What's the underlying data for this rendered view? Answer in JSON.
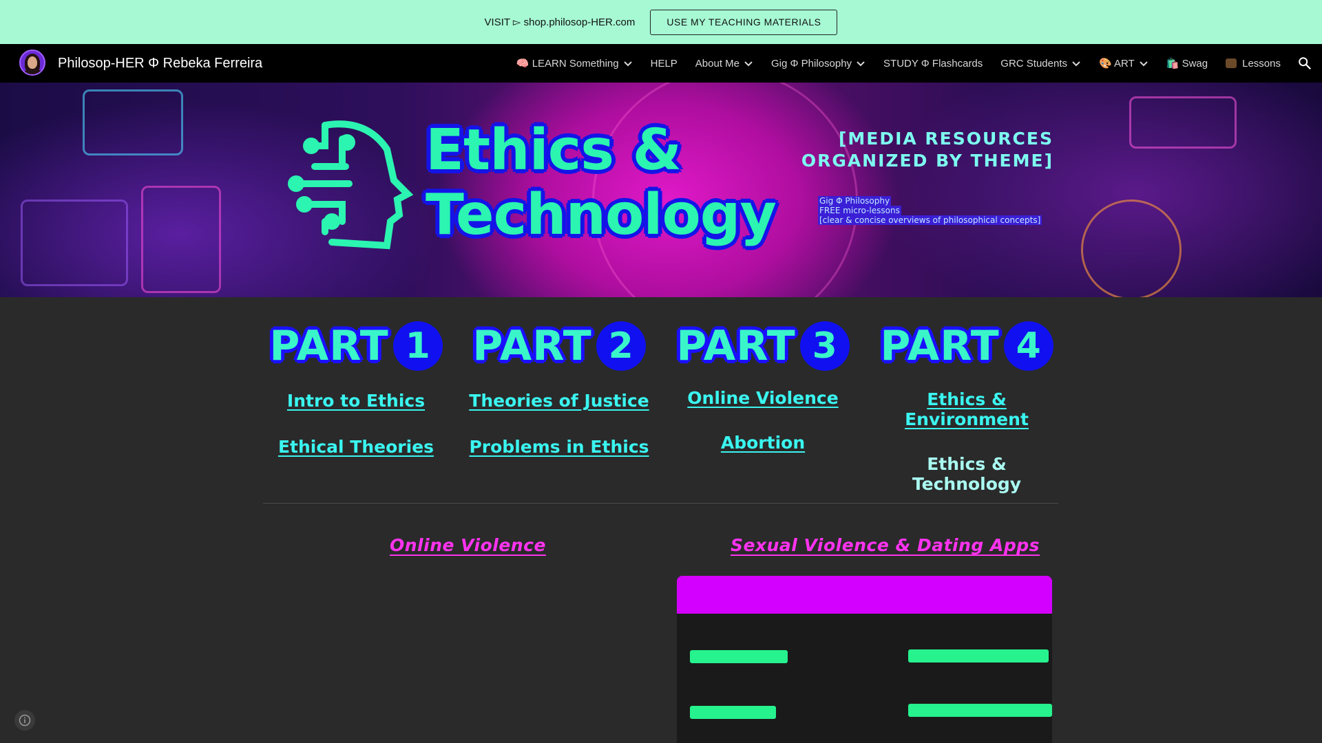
{
  "announcement": {
    "text": "VISIT ▻ shop.philosop-HER.com",
    "button_label": "USE MY TEACHING MATERIALS"
  },
  "nav": {
    "site_title": "Philosop-HER Φ Rebeka Ferreira",
    "items": [
      {
        "label": "🧠 LEARN Something",
        "dropdown": true,
        "icon": "brain-icon"
      },
      {
        "label": "HELP",
        "dropdown": false
      },
      {
        "label": "About Me",
        "dropdown": true
      },
      {
        "label": "Gig Φ Philosophy",
        "dropdown": true
      },
      {
        "label": "STUDY Φ Flashcards",
        "dropdown": false
      },
      {
        "label": "GRC Students",
        "dropdown": true
      },
      {
        "label": "🎨 ART",
        "dropdown": true,
        "icon": "palette-icon"
      },
      {
        "label": "🛍️ Swag",
        "dropdown": false,
        "icon": "shopping-bag-icon"
      },
      {
        "label": "Lessons",
        "dropdown": false,
        "icon": "teacher-icon"
      }
    ],
    "search_icon": "search-icon"
  },
  "hero": {
    "title_line1": "Ethics &",
    "title_line2": "Technology",
    "subtitle_line1": "[MEDIA RESOURCES",
    "subtitle_line2": "ORGANIZED BY THEME]",
    "caption_line1": "Gig Φ Philosophy",
    "caption_line2": "FREE micro-lessons",
    "caption_line3": "[clear & concise overviews of philosophical concepts]"
  },
  "parts": [
    {
      "word": "PART",
      "number": "1",
      "link1": "Intro to Ethics",
      "link2": "Ethical Theories"
    },
    {
      "word": "PART",
      "number": "2",
      "link1": "Theories of Justice",
      "link2": "Problems in Ethics"
    },
    {
      "word": "PART",
      "number": "3",
      "link1": "Online Violence",
      "link2": "Abortion"
    },
    {
      "word": "PART",
      "number": "4",
      "link1": "Ethics & Environment",
      "link2": "Ethics & Technology"
    }
  ],
  "sections": {
    "left_title": "Online Violence",
    "right_title": "Sexual Violence & Dating Apps"
  },
  "colors": {
    "announcement_bg": "#a6f9d3",
    "nav_bg": "#000000",
    "page_bg": "#2a2a2a",
    "accent_teal": "#3af5c9",
    "accent_blue": "#1010f0",
    "accent_magenta": "#ff33f0",
    "embed_header": "#d400ff",
    "embed_bar": "#26f28e"
  }
}
